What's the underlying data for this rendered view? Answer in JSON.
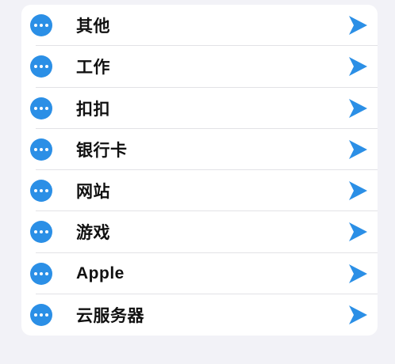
{
  "list": {
    "accent_color": "#2b8fe6",
    "items": [
      {
        "label": "其他",
        "icon": "more-icon",
        "action_icon": "send-arrow-icon"
      },
      {
        "label": "工作",
        "icon": "more-icon",
        "action_icon": "send-arrow-icon"
      },
      {
        "label": "扣扣",
        "icon": "more-icon",
        "action_icon": "send-arrow-icon"
      },
      {
        "label": "银行卡",
        "icon": "more-icon",
        "action_icon": "send-arrow-icon"
      },
      {
        "label": "网站",
        "icon": "more-icon",
        "action_icon": "send-arrow-icon"
      },
      {
        "label": "游戏",
        "icon": "more-icon",
        "action_icon": "send-arrow-icon"
      },
      {
        "label": "Apple",
        "icon": "more-icon",
        "action_icon": "send-arrow-icon"
      },
      {
        "label": "云服务器",
        "icon": "more-icon",
        "action_icon": "send-arrow-icon"
      }
    ]
  }
}
